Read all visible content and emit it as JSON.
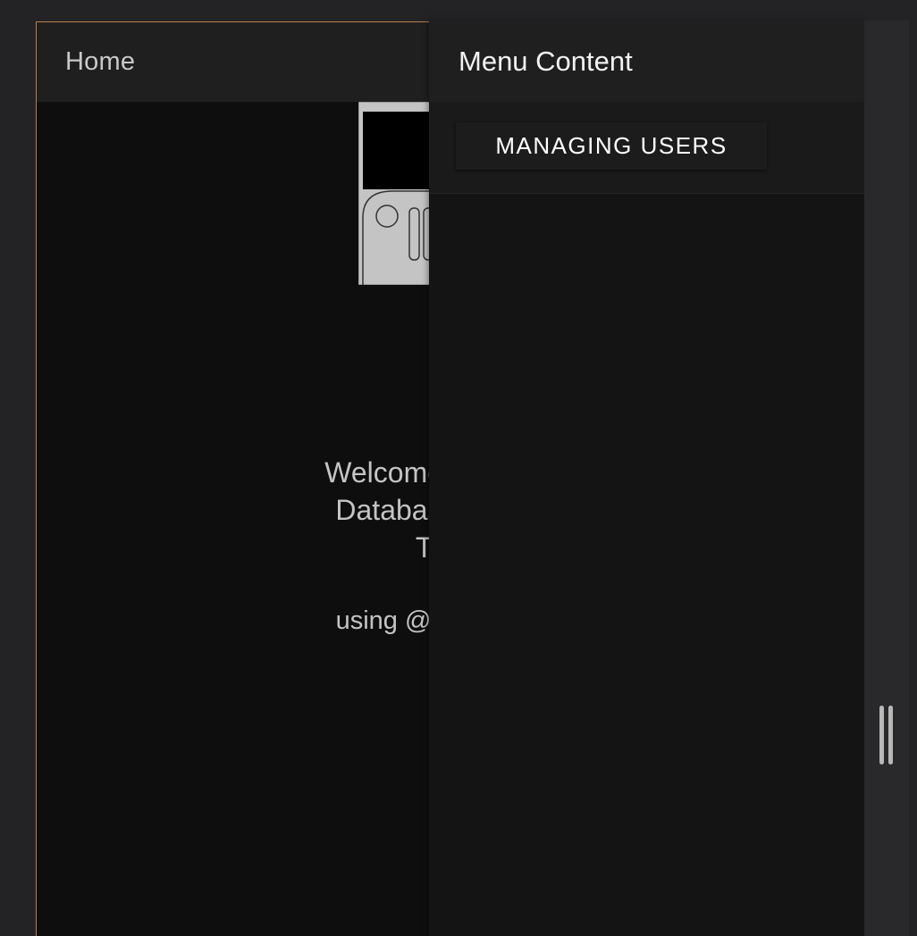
{
  "app": {
    "title": "Home",
    "welcome_lines": [
      "Welcome to the I",
      "Database CRU",
      "Tu"
    ],
    "using_text": "using @capacito"
  },
  "menu": {
    "title": "Menu Content",
    "items": [
      {
        "label": "MANAGING USERS"
      }
    ]
  },
  "colors": {
    "background": "#232326",
    "app_background": "#0e0e0e",
    "header_background": "#1f1f1f",
    "menu_background": "#141414",
    "frame_border": "#b8804a",
    "text_muted": "#c4c4c4",
    "text_bright": "#ffffff"
  },
  "icons": {
    "logo": "floppy-disk-icon",
    "resize": "resize-handle-icon"
  }
}
